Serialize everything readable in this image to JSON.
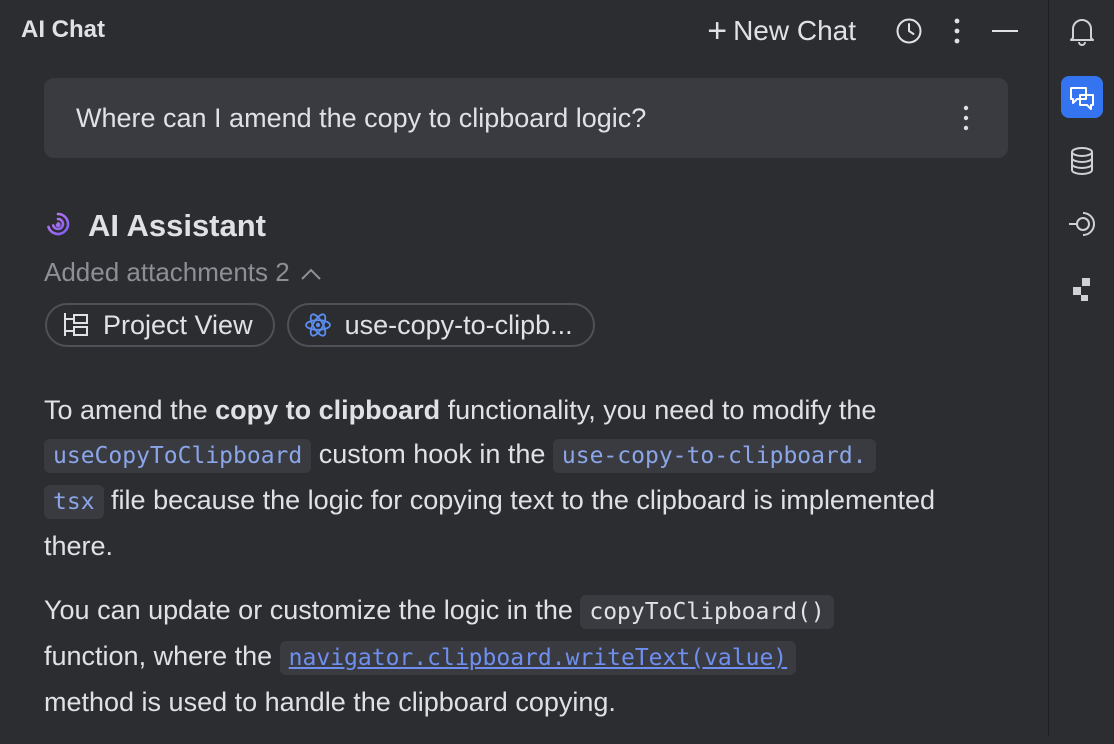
{
  "header": {
    "title": "AI Chat",
    "new_chat_label": "New Chat"
  },
  "question": {
    "text": "Where can I amend the copy to clipboard logic?"
  },
  "assistant": {
    "name": "AI Assistant",
    "attachments_label": "Added attachments 2",
    "attachments": [
      {
        "label": "Project View",
        "icon": "project-view-icon"
      },
      {
        "label": "use-copy-to-clipb...",
        "icon": "react-icon"
      }
    ]
  },
  "answer": {
    "p1_a": "To amend the ",
    "p1_bold": "copy to clipboard",
    "p1_b": " functionality, you need to modify the ",
    "p1_code1": "useCopyToClipboard",
    "p1_c": " custom hook in the ",
    "p1_code2": "use-copy-to-clipboard.",
    "p1_code3": "tsx",
    "p1_d": " file because the logic for copying text to the clipboard is implemented there.",
    "p2_a": "You can update or customize the logic in the ",
    "p2_code1": "copyToClipboard()",
    "p2_b": " function, where the ",
    "p2_code2": "navigator.clipboard.writeText(value)",
    "p2_c": " method is used to handle the clipboard copying."
  },
  "right_bar": {
    "icons": [
      "bell-icon",
      "ai-chat-icon",
      "database-icon",
      "vcs-icon",
      "plugin-icon"
    ],
    "active": "ai-chat-icon"
  },
  "colors": {
    "background": "#2b2d30",
    "bubble": "#393b40",
    "accent": "#3574f0",
    "code_text": "#8ba6e8",
    "muted": "#8c8f96"
  }
}
